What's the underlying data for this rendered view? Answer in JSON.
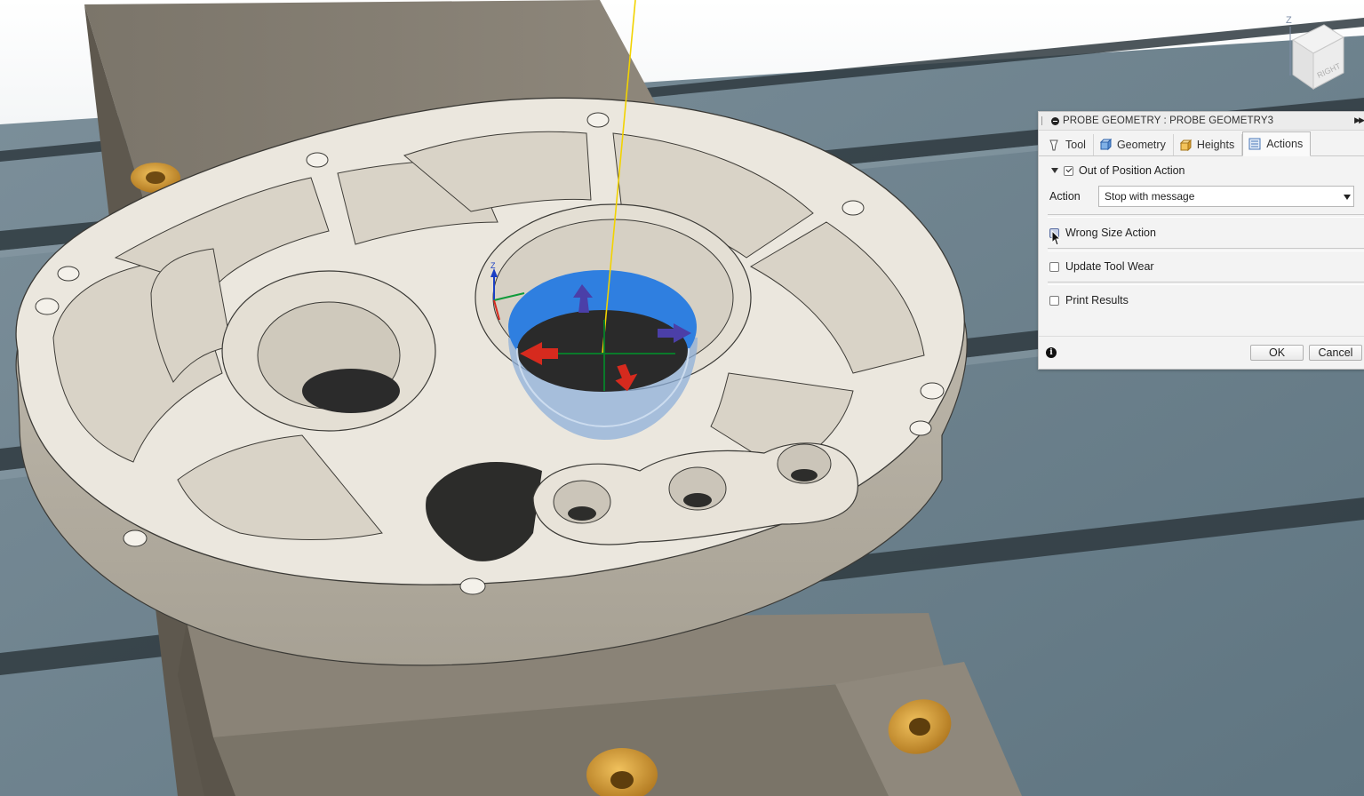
{
  "dialog": {
    "title": "PROBE GEOMETRY : PROBE GEOMETRY3",
    "tabs": [
      {
        "label": "Tool",
        "icon": "tool-icon",
        "active": false
      },
      {
        "label": "Geometry",
        "icon": "geometry-icon",
        "active": false
      },
      {
        "label": "Heights",
        "icon": "heights-icon",
        "active": false
      },
      {
        "label": "Actions",
        "icon": "actions-icon",
        "active": true
      }
    ],
    "out_of_position": {
      "label": "Out of Position Action",
      "checked": true,
      "expanded": true,
      "action_label": "Action",
      "action_value": "Stop with message"
    },
    "wrong_size": {
      "label": "Wrong Size Action",
      "checked": false
    },
    "update_tool_wear": {
      "label": "Update Tool Wear",
      "checked": false
    },
    "print_results": {
      "label": "Print Results",
      "checked": false
    },
    "ok_label": "OK",
    "cancel_label": "Cancel"
  },
  "viewcube": {
    "face_label": "RIGHT",
    "axis_label": "Z"
  },
  "colors": {
    "selection_blue": "#2f7fe0",
    "part_body": "#e6e1d7",
    "table": "#6b818f",
    "arrow_red": "#d62a1e",
    "arrow_purple": "#4b3fa8",
    "probe_yellow": "#f2d300",
    "bolt_gold": "#d6a03a"
  }
}
